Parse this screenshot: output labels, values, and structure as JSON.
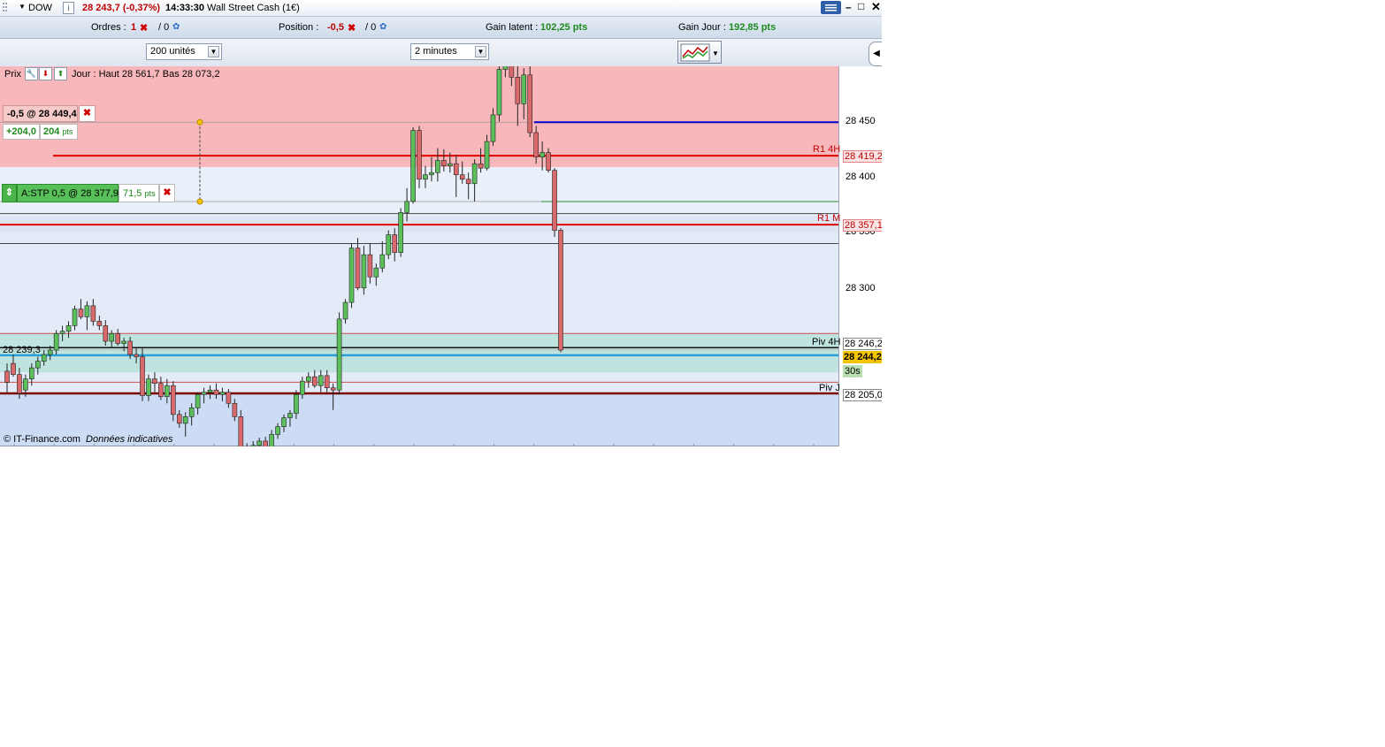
{
  "titlebar": {
    "symbol": "DOW",
    "info_icon": "i",
    "quote": "28 243,7 (-0,37%)",
    "time": "14:33:30",
    "instrument": "Wall Street Cash (1€)",
    "icons": [
      "menu-icon",
      "minimize-icon",
      "maximize-icon",
      "close-icon"
    ]
  },
  "infobar": {
    "orders_label": "Ordres :",
    "orders_count": "1",
    "orders_other": "/ 0",
    "position_label": "Position :",
    "position_value": "-0,5",
    "position_other": "/ 0",
    "gain_latent_label": "Gain latent :",
    "gain_latent_value": "102,25 pts",
    "gain_jour_label": "Gain Jour :",
    "gain_jour_value": "192,85 pts"
  },
  "toolbar": {
    "units_select": "200 unités",
    "period_select": "2 minutes"
  },
  "chart_header": {
    "prix_label": "Prix",
    "day_info": "Jour : Haut 28 561,7  Bas 28 073,2"
  },
  "position_panel": {
    "position": "-0,5 @ 28 449,4",
    "gain_value": "+204,0",
    "gain_pts_num": "204",
    "gain_pts_unit": "pts"
  },
  "stop_panel": {
    "label": "A:STP  0,5 @ 28 377,9",
    "distance_num": "71,5",
    "distance_unit": "pts"
  },
  "line_labels": {
    "r1_4h": "R1 4H",
    "r1_m": "R1 M",
    "piv_4h": "Piv 4H",
    "piv_j": "Piv J",
    "left_level": "28 239,3"
  },
  "price_axis": {
    "ticks": [
      "28 450",
      "28 400",
      "28 350",
      "28 300"
    ],
    "tag_r1_4h": "28 419,2",
    "tag_r1_m": "28 357,1",
    "tag_piv_4h": "28 246,2",
    "tag_current": "28 244,2",
    "tag_countdown": "30s",
    "tag_piv_j": "28 205,0"
  },
  "footer": {
    "source": "© IT-Finance.com",
    "disclaimer": "Données indicatives"
  },
  "colors": {
    "up_candle": "#5cbf5c",
    "down_candle": "#d9696b",
    "resistance_zone": "#f8b8bb",
    "pivot_zone": "#bfe3df",
    "chart_bg": "#eaf0fa",
    "position_line": "#0000cc",
    "level_line": "#e00000",
    "current_price_tag": "#f5c400"
  },
  "chart_data": {
    "type": "candlestick",
    "timeframe": "2 minutes",
    "ylim": [
      28185,
      28580
    ],
    "price_axis_ticks": [
      28300,
      28350,
      28400,
      28450
    ],
    "levels": [
      {
        "name": "R1 4H",
        "value": 28419.2
      },
      {
        "name": "R1 M",
        "value": 28357.1
      },
      {
        "name": "Piv 4H",
        "value": 28246.2
      },
      {
        "name": "Piv J",
        "value": 28205.0
      },
      {
        "name": "Position",
        "value": 28449.4
      },
      {
        "name": "A:STP",
        "value": 28377.9
      },
      {
        "name": "Current",
        "value": 28244.2
      },
      {
        "name": "Left level",
        "value": 28239.3
      }
    ],
    "candles": [
      {
        "o": 28225,
        "h": 28232,
        "l": 28206,
        "c": 28215
      },
      {
        "o": 28232,
        "h": 28240,
        "l": 28220,
        "c": 28222
      },
      {
        "o": 28222,
        "h": 28228,
        "l": 28200,
        "c": 28205
      },
      {
        "o": 28208,
        "h": 28222,
        "l": 28202,
        "c": 28218
      },
      {
        "o": 28218,
        "h": 28232,
        "l": 28212,
        "c": 28228
      },
      {
        "o": 28228,
        "h": 28238,
        "l": 28222,
        "c": 28234
      },
      {
        "o": 28234,
        "h": 28244,
        "l": 28230,
        "c": 28240
      },
      {
        "o": 28240,
        "h": 28248,
        "l": 28235,
        "c": 28244
      },
      {
        "o": 28244,
        "h": 28262,
        "l": 28240,
        "c": 28259
      },
      {
        "o": 28259,
        "h": 28266,
        "l": 28252,
        "c": 28261
      },
      {
        "o": 28261,
        "h": 28270,
        "l": 28255,
        "c": 28266
      },
      {
        "o": 28266,
        "h": 28284,
        "l": 28262,
        "c": 28281
      },
      {
        "o": 28281,
        "h": 28290,
        "l": 28272,
        "c": 28274
      },
      {
        "o": 28274,
        "h": 28288,
        "l": 28262,
        "c": 28284
      },
      {
        "o": 28284,
        "h": 28290,
        "l": 28266,
        "c": 28270
      },
      {
        "o": 28270,
        "h": 28275,
        "l": 28262,
        "c": 28266
      },
      {
        "o": 28266,
        "h": 28271,
        "l": 28248,
        "c": 28252
      },
      {
        "o": 28252,
        "h": 28262,
        "l": 28246,
        "c": 28259
      },
      {
        "o": 28259,
        "h": 28263,
        "l": 28248,
        "c": 28250
      },
      {
        "o": 28250,
        "h": 28255,
        "l": 28243,
        "c": 28252
      },
      {
        "o": 28252,
        "h": 28256,
        "l": 28236,
        "c": 28240
      },
      {
        "o": 28240,
        "h": 28246,
        "l": 28232,
        "c": 28238
      },
      {
        "o": 28238,
        "h": 28246,
        "l": 28198,
        "c": 28203
      },
      {
        "o": 28203,
        "h": 28222,
        "l": 28198,
        "c": 28218
      },
      {
        "o": 28218,
        "h": 28224,
        "l": 28206,
        "c": 28214
      },
      {
        "o": 28214,
        "h": 28220,
        "l": 28199,
        "c": 28202
      },
      {
        "o": 28202,
        "h": 28218,
        "l": 28196,
        "c": 28212
      },
      {
        "o": 28212,
        "h": 28216,
        "l": 28180,
        "c": 28186
      },
      {
        "o": 28186,
        "h": 28190,
        "l": 28174,
        "c": 28178
      },
      {
        "o": 28178,
        "h": 28188,
        "l": 28166,
        "c": 28184
      },
      {
        "o": 28184,
        "h": 28196,
        "l": 28176,
        "c": 28192
      },
      {
        "o": 28192,
        "h": 28206,
        "l": 28186,
        "c": 28204
      },
      {
        "o": 28204,
        "h": 28210,
        "l": 28196,
        "c": 28206
      },
      {
        "o": 28206,
        "h": 28212,
        "l": 28200,
        "c": 28208
      },
      {
        "o": 28208,
        "h": 28214,
        "l": 28200,
        "c": 28204
      },
      {
        "o": 28204,
        "h": 28210,
        "l": 28198,
        "c": 28206
      },
      {
        "o": 28206,
        "h": 28209,
        "l": 28192,
        "c": 28196
      },
      {
        "o": 28196,
        "h": 28200,
        "l": 28180,
        "c": 28184
      },
      {
        "o": 28184,
        "h": 28190,
        "l": 28150,
        "c": 28156
      },
      {
        "o": 28156,
        "h": 28160,
        "l": 28146,
        "c": 28150
      },
      {
        "o": 28150,
        "h": 28162,
        "l": 28146,
        "c": 28158
      },
      {
        "o": 28158,
        "h": 28165,
        "l": 28152,
        "c": 28162
      },
      {
        "o": 28162,
        "h": 28166,
        "l": 28152,
        "c": 28156
      },
      {
        "o": 28156,
        "h": 28172,
        "l": 28152,
        "c": 28168
      },
      {
        "o": 28168,
        "h": 28178,
        "l": 28164,
        "c": 28175
      },
      {
        "o": 28175,
        "h": 28186,
        "l": 28170,
        "c": 28183
      },
      {
        "o": 28183,
        "h": 28190,
        "l": 28175,
        "c": 28187
      },
      {
        "o": 28187,
        "h": 28208,
        "l": 28182,
        "c": 28204
      },
      {
        "o": 28204,
        "h": 28220,
        "l": 28200,
        "c": 28216
      },
      {
        "o": 28216,
        "h": 28224,
        "l": 28210,
        "c": 28220
      },
      {
        "o": 28220,
        "h": 28226,
        "l": 28210,
        "c": 28212
      },
      {
        "o": 28212,
        "h": 28226,
        "l": 28206,
        "c": 28221
      },
      {
        "o": 28221,
        "h": 28226,
        "l": 28206,
        "c": 28210
      },
      {
        "o": 28210,
        "h": 28214,
        "l": 28190,
        "c": 28208
      },
      {
        "o": 28208,
        "h": 28278,
        "l": 28204,
        "c": 28272
      },
      {
        "o": 28272,
        "h": 28290,
        "l": 28268,
        "c": 28287
      },
      {
        "o": 28287,
        "h": 28340,
        "l": 28282,
        "c": 28336
      },
      {
        "o": 28336,
        "h": 28345,
        "l": 28298,
        "c": 28300
      },
      {
        "o": 28300,
        "h": 28338,
        "l": 28294,
        "c": 28330
      },
      {
        "o": 28330,
        "h": 28340,
        "l": 28304,
        "c": 28310
      },
      {
        "o": 28310,
        "h": 28322,
        "l": 28302,
        "c": 28318
      },
      {
        "o": 28318,
        "h": 28342,
        "l": 28314,
        "c": 28330
      },
      {
        "o": 28330,
        "h": 28352,
        "l": 28326,
        "c": 28348
      },
      {
        "o": 28348,
        "h": 28354,
        "l": 28324,
        "c": 28332
      },
      {
        "o": 28332,
        "h": 28372,
        "l": 28328,
        "c": 28368
      },
      {
        "o": 28368,
        "h": 28390,
        "l": 28360,
        "c": 28378
      },
      {
        "o": 28378,
        "h": 28445,
        "l": 28376,
        "c": 28442
      },
      {
        "o": 28442,
        "h": 28446,
        "l": 28390,
        "c": 28398
      },
      {
        "o": 28398,
        "h": 28410,
        "l": 28390,
        "c": 28402
      },
      {
        "o": 28402,
        "h": 28418,
        "l": 28396,
        "c": 28404
      },
      {
        "o": 28404,
        "h": 28426,
        "l": 28396,
        "c": 28415
      },
      {
        "o": 28415,
        "h": 28425,
        "l": 28405,
        "c": 28410
      },
      {
        "o": 28410,
        "h": 28422,
        "l": 28404,
        "c": 28412
      },
      {
        "o": 28412,
        "h": 28420,
        "l": 28382,
        "c": 28402
      },
      {
        "o": 28402,
        "h": 28414,
        "l": 28394,
        "c": 28398
      },
      {
        "o": 28398,
        "h": 28404,
        "l": 28380,
        "c": 28394
      },
      {
        "o": 28394,
        "h": 28416,
        "l": 28378,
        "c": 28412
      },
      {
        "o": 28412,
        "h": 28426,
        "l": 28404,
        "c": 28408
      },
      {
        "o": 28408,
        "h": 28438,
        "l": 28406,
        "c": 28432
      },
      {
        "o": 28432,
        "h": 28462,
        "l": 28428,
        "c": 28456
      },
      {
        "o": 28456,
        "h": 28505,
        "l": 28450,
        "c": 28497
      },
      {
        "o": 28497,
        "h": 28572,
        "l": 28490,
        "c": 28562
      },
      {
        "o": 28562,
        "h": 28565,
        "l": 28482,
        "c": 28490
      },
      {
        "o": 28490,
        "h": 28520,
        "l": 28446,
        "c": 28466
      },
      {
        "o": 28466,
        "h": 28498,
        "l": 28452,
        "c": 28492
      },
      {
        "o": 28492,
        "h": 28562,
        "l": 28436,
        "c": 28440
      },
      {
        "o": 28440,
        "h": 28446,
        "l": 28412,
        "c": 28418
      },
      {
        "o": 28418,
        "h": 28432,
        "l": 28406,
        "c": 28422
      },
      {
        "o": 28422,
        "h": 28426,
        "l": 28404,
        "c": 28406
      },
      {
        "o": 28406,
        "h": 28408,
        "l": 28346,
        "c": 28352
      },
      {
        "o": 28352,
        "h": 28354,
        "l": 28242,
        "c": 28244
      }
    ]
  }
}
